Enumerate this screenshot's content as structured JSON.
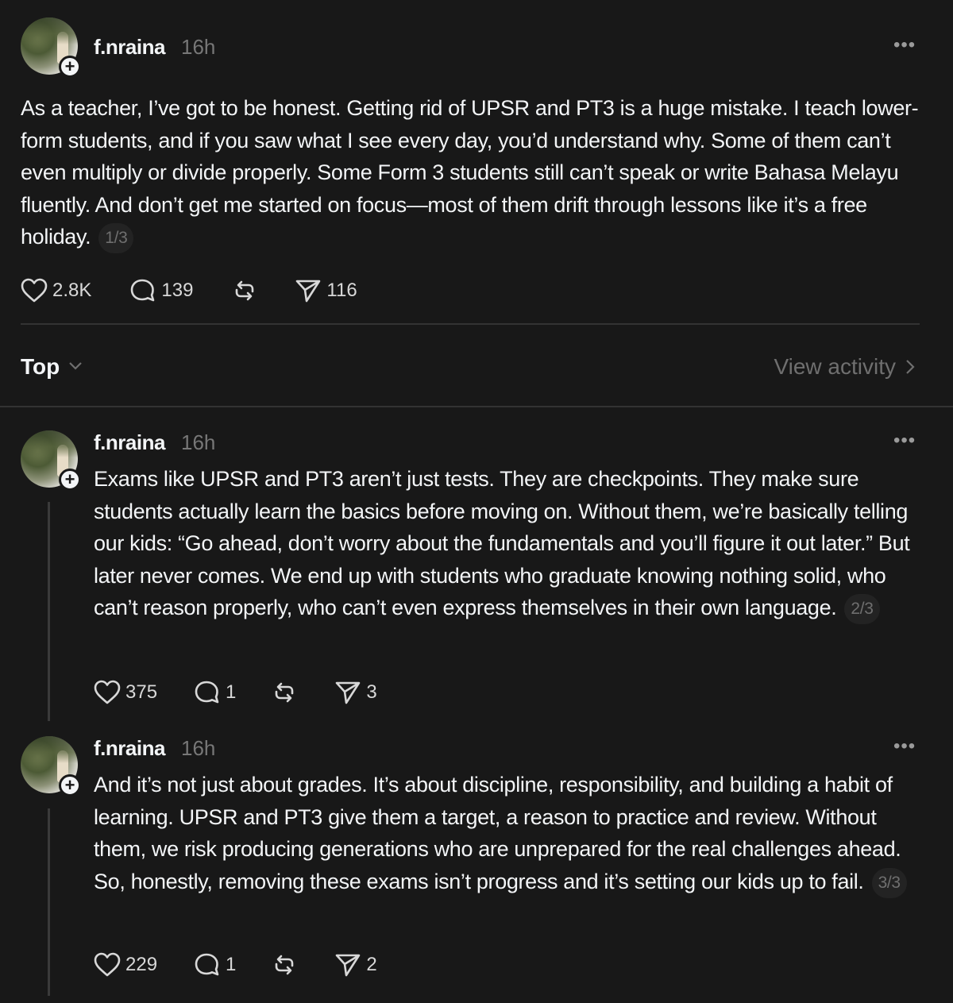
{
  "main_post": {
    "username": "f.nraina",
    "time": "16h",
    "text": "As a teacher, I’ve got to be honest. Getting rid of UPSR and PT3 is a huge mistake. I teach lower-form students, and if you saw what I see every day, you’d understand why. Some of them can’t even multiply or divide properly. Some Form 3 students still can’t speak or write Bahasa Melayu fluently. And don’t get me started on focus—most of them drift through lessons like it’s a free holiday.",
    "pager": "1/3",
    "likes": "2.8K",
    "comments": "139",
    "shares": "116"
  },
  "sort_bar": {
    "label": "Top",
    "view_activity": "View activity"
  },
  "replies": [
    {
      "username": "f.nraina",
      "time": "16h",
      "text": "Exams like UPSR and PT3 aren’t just tests. They are checkpoints. They make sure students actually learn the basics before moving on. Without them, we’re basically telling our kids: “Go ahead, don’t worry about the fundamentals and you’ll figure it out later.” But later never comes. We end up with students who graduate knowing nothing solid, who can’t reason properly, who can’t even express themselves in their own language.",
      "pager": "2/3",
      "likes": "375",
      "comments": "1",
      "shares": "3"
    },
    {
      "username": "f.nraina",
      "time": "16h",
      "text": "And it’s not just about grades. It’s about discipline, responsibility, and building a habit of learning. UPSR and PT3 give them a target, a reason to practice and review. Without them, we risk producing generations who are unprepared for the real challenges ahead. So, honestly, removing these exams isn’t progress and it’s setting our kids up to fail.",
      "pager": "3/3",
      "likes": "229",
      "comments": "1",
      "shares": "2"
    }
  ],
  "icons": {
    "more": "more-horizontal-icon",
    "like": "heart-icon",
    "comment": "speech-bubble-icon",
    "repost": "repost-icon",
    "share": "send-icon",
    "follow": "plus-icon",
    "sort": "chevron-down-icon",
    "activity": "chevron-right-icon"
  },
  "colors": {
    "background": "#181818",
    "text": "#f3f5f7",
    "muted": "#777777",
    "divider": "#333333"
  }
}
